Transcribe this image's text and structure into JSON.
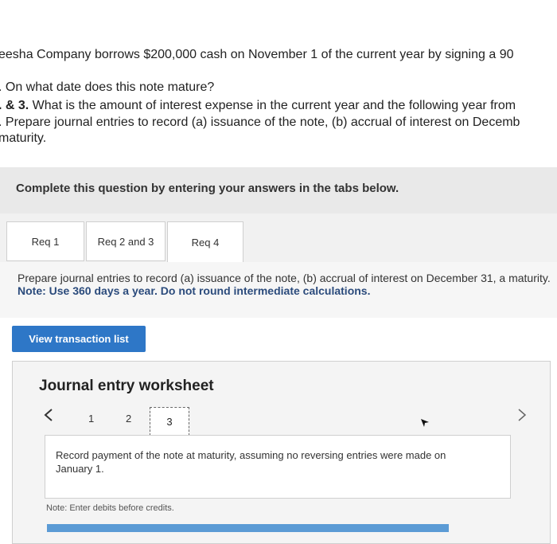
{
  "problem": {
    "line1": "eesha Company borrows $200,000 cash on November 1 of the current year by signing a 90",
    "line2": ". On what date does this note mature?",
    "line3_prefix": ". & 3.",
    "line3_text": " What is the amount of interest expense in the current year and the following year from",
    "line4": ". Prepare journal entries to record (a) issuance of the note, (b) accrual of interest on Decemb",
    "line5": "maturity."
  },
  "complete_bar": {
    "text": "Complete this question by entering your answers in the tabs below."
  },
  "tabs": [
    {
      "label": "Req 1"
    },
    {
      "label": "Req 2 and 3"
    },
    {
      "label": "Req 4"
    }
  ],
  "instructions": {
    "text": "Prepare journal entries to record (a) issuance of the note, (b) accrual of interest on December 31, a maturity.",
    "note": "Note: Use 360 days a year. Do not round intermediate calculations."
  },
  "view_button": {
    "label": "View transaction list"
  },
  "worksheet": {
    "title": "Journal entry worksheet",
    "pages": [
      "1",
      "2",
      "3"
    ],
    "current_page": "3",
    "description": "Record payment of the note at maturity, assuming no reversing entries were made on January 1.",
    "note": "Note: Enter debits before credits."
  },
  "icons": {
    "prev": "chevron-left-icon",
    "next": "chevron-right-icon",
    "cursor": "mouse-pointer-icon"
  }
}
